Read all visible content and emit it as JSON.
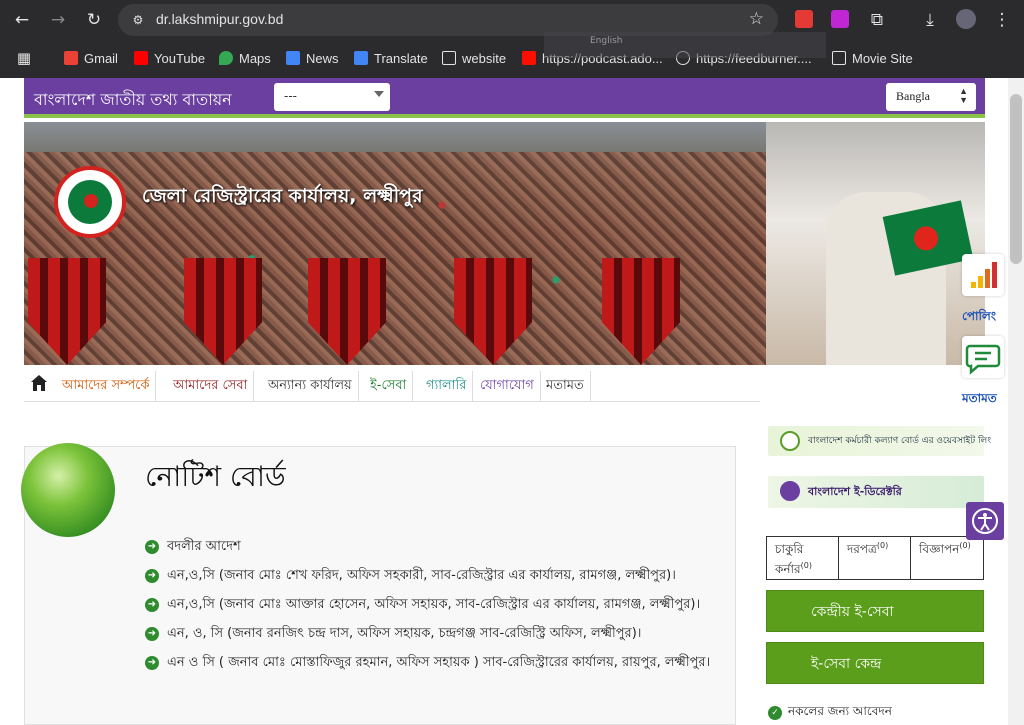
{
  "browser": {
    "url": "dr.lakshmipur.gov.bd",
    "bookmarks": [
      {
        "label": "Gmail",
        "icon": "gmail-icon",
        "color": "#ea4335"
      },
      {
        "label": "YouTube",
        "icon": "youtube-icon",
        "color": "#ff0000"
      },
      {
        "label": "Maps",
        "icon": "maps-icon",
        "color": "#34a853"
      },
      {
        "label": "News",
        "icon": "news-icon",
        "color": "#4285f4"
      },
      {
        "label": "Translate",
        "icon": "translate-icon",
        "color": "#4285f4"
      },
      {
        "label": "website",
        "icon": "folder-icon",
        "color": "#e3e3e3"
      },
      {
        "label": "https://podcast.ado...",
        "icon": "adobe-icon",
        "color": "#fa0f00"
      },
      {
        "label": "https://feedburner....",
        "icon": "globe-icon",
        "color": "#e3e3e3"
      },
      {
        "label": "Movie Site",
        "icon": "folder-icon",
        "color": "#e3e3e3"
      }
    ],
    "overlay_label": "English"
  },
  "topbar": {
    "portal_name": "বাংলাদেশ জাতীয় তথ্য বাতায়ন",
    "select_value": "---",
    "language": "Bangla"
  },
  "banner": {
    "office_title": "জেলা রেজিস্ট্রারের কার্যালয়, লক্ষ্মীপুর"
  },
  "menu": {
    "items": [
      {
        "label": "আমাদের সম্পর্কে",
        "color": "#d35400"
      },
      {
        "label": "আমাদের সেবা",
        "color": "#8b1a1a"
      },
      {
        "label": "অন্যান্য কার্যালয়",
        "color": "#333333"
      },
      {
        "label": "ই-সেবা",
        "color": "#1a7a2a"
      },
      {
        "label": "গ্যালারি",
        "color": "#1a8a8a"
      },
      {
        "label": "যোগাযোগ",
        "color": "#6b3fa0"
      },
      {
        "label": "মতামত",
        "color": "#333333"
      }
    ]
  },
  "notice": {
    "title": "নোটিশ বোর্ড",
    "items": [
      "বদলীর আদেশ",
      "এন,ও,সি (জনাব মোঃ শেখ ফরিদ, অফিস সহকারী, সাব-রেজিস্ট্রার এর কার্যালয়, রামগঞ্জ, লক্ষ্মীপুর)।",
      "এন,ও,সি (জনাব মোঃ আক্তার হোসেন, অফিস সহায়ক, সাব-রেজিস্ট্রার এর কার্যালয়, রামগঞ্জ, লক্ষ্মীপুর)।",
      "এন, ও, সি (জনাব রনজিৎ চন্দ্র দাস, অফিস সহায়ক, চন্দ্রগঞ্জ সাব-রেজিস্ট্রি অফিস, লক্ষ্মীপুর)।",
      "এন ও সি ( জনাব মোঃ মোস্তাফিজুর রহমান, অফিস সহায়ক ) সাব-রেজিস্ট্রারের কার্যালয়, রায়পুর, লক্ষ্মীপুর।"
    ]
  },
  "sidebar": {
    "banner1": "বাংলাদেশ কর্মচারী কল্যাণ বোর্ড এর ওয়েবসাইট লিং",
    "banner2": "বাংলাদেশ ই-ডিরেক্টরি",
    "tabs": [
      {
        "label": "চাকুরি কর্নার",
        "count": "(0)"
      },
      {
        "label": "দরপত্র",
        "count": "(0)"
      },
      {
        "label": "বিজ্ঞাপন",
        "count": "(0)"
      }
    ],
    "btn1": "কেন্দ্রীয় ই-সেবা",
    "btn2": "ই-সেবা কেন্দ্র",
    "apply": "নকলের জন্য আবেদন"
  },
  "floats": {
    "polling": "পোলিং",
    "feedback": "মতামত"
  }
}
